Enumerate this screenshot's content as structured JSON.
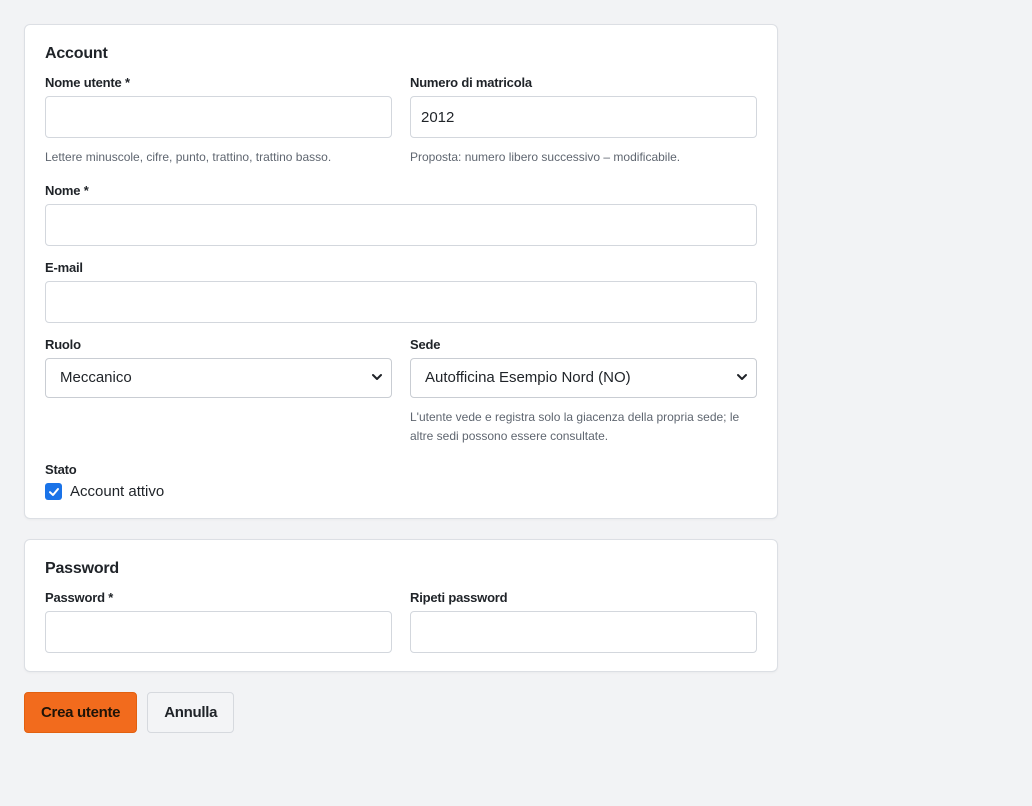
{
  "account": {
    "title": "Account",
    "username": {
      "label": "Nome utente *",
      "value": "",
      "help": "Lettere minuscole, cifre, punto, trattino, trattino basso."
    },
    "matricola": {
      "label": "Numero di matricola",
      "value": "2012",
      "help": "Proposta: numero libero successivo – modificabile."
    },
    "name": {
      "label": "Nome *",
      "value": ""
    },
    "email": {
      "label": "E-mail",
      "value": ""
    },
    "role": {
      "label": "Ruolo",
      "selected": "Meccanico",
      "icon": "chevron-down-icon"
    },
    "site": {
      "label": "Sede",
      "selected": "Autofficina Esempio Nord (NO)",
      "icon": "chevron-down-icon",
      "help": "L'utente vede e registra solo la giacenza della propria sede; le altre sedi possono essere consultate."
    },
    "status": {
      "label": "Stato",
      "checkbox_label": "Account attivo",
      "checked": true,
      "check_color": "#1a73e8"
    }
  },
  "password": {
    "title": "Password",
    "password": {
      "label": "Password *",
      "value": ""
    },
    "repeat": {
      "label": "Ripeti password",
      "value": ""
    }
  },
  "actions": {
    "create_label": "Crea utente",
    "cancel_label": "Annulla",
    "primary_color": "#f26b1d"
  }
}
